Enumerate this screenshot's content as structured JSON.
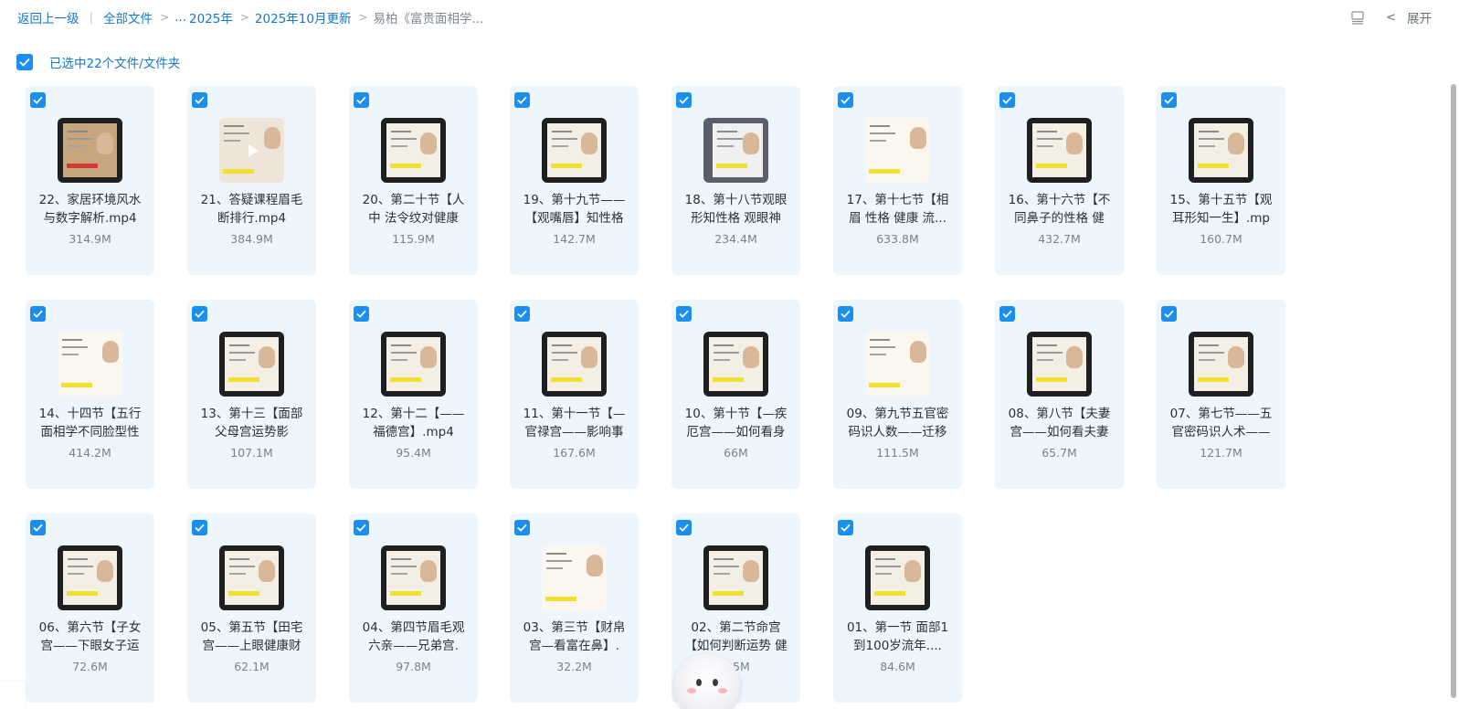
{
  "breadcrumb": {
    "back": "返回上一级",
    "all_files": "全部文件",
    "ellipsis": "...",
    "year": "2025年",
    "month_update": "2025年10月更新",
    "current": "易柏《富贵面相学..."
  },
  "toolbar": {
    "view_icon": "list-view-icon",
    "expand_label": "展开"
  },
  "selection": {
    "label": "已选中22个文件/文件夹",
    "checked": true
  },
  "files": [
    {
      "name": "22、家居环境风水与数字解析.mp4",
      "size": "314.9M",
      "thumb": "photo"
    },
    {
      "name": "21、答疑课程眉毛断排行.mp4",
      "size": "384.9M",
      "thumb": "light"
    },
    {
      "name": "20、第二十节【人中 法令纹对健康",
      "size": "115.9M",
      "thumb": "dark"
    },
    {
      "name": "19、第十九节——【观嘴唇】知性格",
      "size": "142.7M",
      "thumb": "dark"
    },
    {
      "name": "18、第十八节观眼形知性格 观眼神",
      "size": "234.4M",
      "thumb": "grey"
    },
    {
      "name": "17、第十七节【相眉 性格 健康 流...",
      "size": "633.8M",
      "thumb": "paper"
    },
    {
      "name": "16、第十六节【不同鼻子的性格 健",
      "size": "432.7M",
      "thumb": "dark"
    },
    {
      "name": "15、第十五节【观耳形知一生】.mp",
      "size": "160.7M",
      "thumb": "dark"
    },
    {
      "name": "14、十四节【五行面相学不同脸型性",
      "size": "414.2M",
      "thumb": "paper"
    },
    {
      "name": "13、第十三【面部父母宫运势影",
      "size": "107.1M",
      "thumb": "dark"
    },
    {
      "name": "12、第十二【——福德宫】.mp4",
      "size": "95.4M",
      "thumb": "dark"
    },
    {
      "name": "11、第十一节【—官禄宫——影响事",
      "size": "167.6M",
      "thumb": "dark"
    },
    {
      "name": "10、第十节【—疾厄宫——如何看身",
      "size": "66M",
      "thumb": "dark"
    },
    {
      "name": "09、第九节五官密码识人数——迁移",
      "size": "111.5M",
      "thumb": "paper"
    },
    {
      "name": "08、第八节【夫妻宫——如何看夫妻",
      "size": "65.7M",
      "thumb": "dark"
    },
    {
      "name": "07、第七节——五官密码识人术——",
      "size": "121.7M",
      "thumb": "dark"
    },
    {
      "name": "06、第六节【子女宫——下眼女子运",
      "size": "72.6M",
      "thumb": "dark"
    },
    {
      "name": "05、第五节【田宅宫——上眼健康财",
      "size": "62.1M",
      "thumb": "dark"
    },
    {
      "name": "04、第四节眉毛观六亲——兄弟宫.",
      "size": "97.8M",
      "thumb": "dark"
    },
    {
      "name": "03、第三节【财帛宫—看富在鼻】.",
      "size": "32.2M",
      "thumb": "paper"
    },
    {
      "name": "02、第二节命宫【如何判断运势 健",
      "size": "3.5M",
      "thumb": "dark"
    },
    {
      "name": "01、第一节 面部1到100岁流年....",
      "size": "84.6M",
      "thumb": "dark"
    }
  ]
}
